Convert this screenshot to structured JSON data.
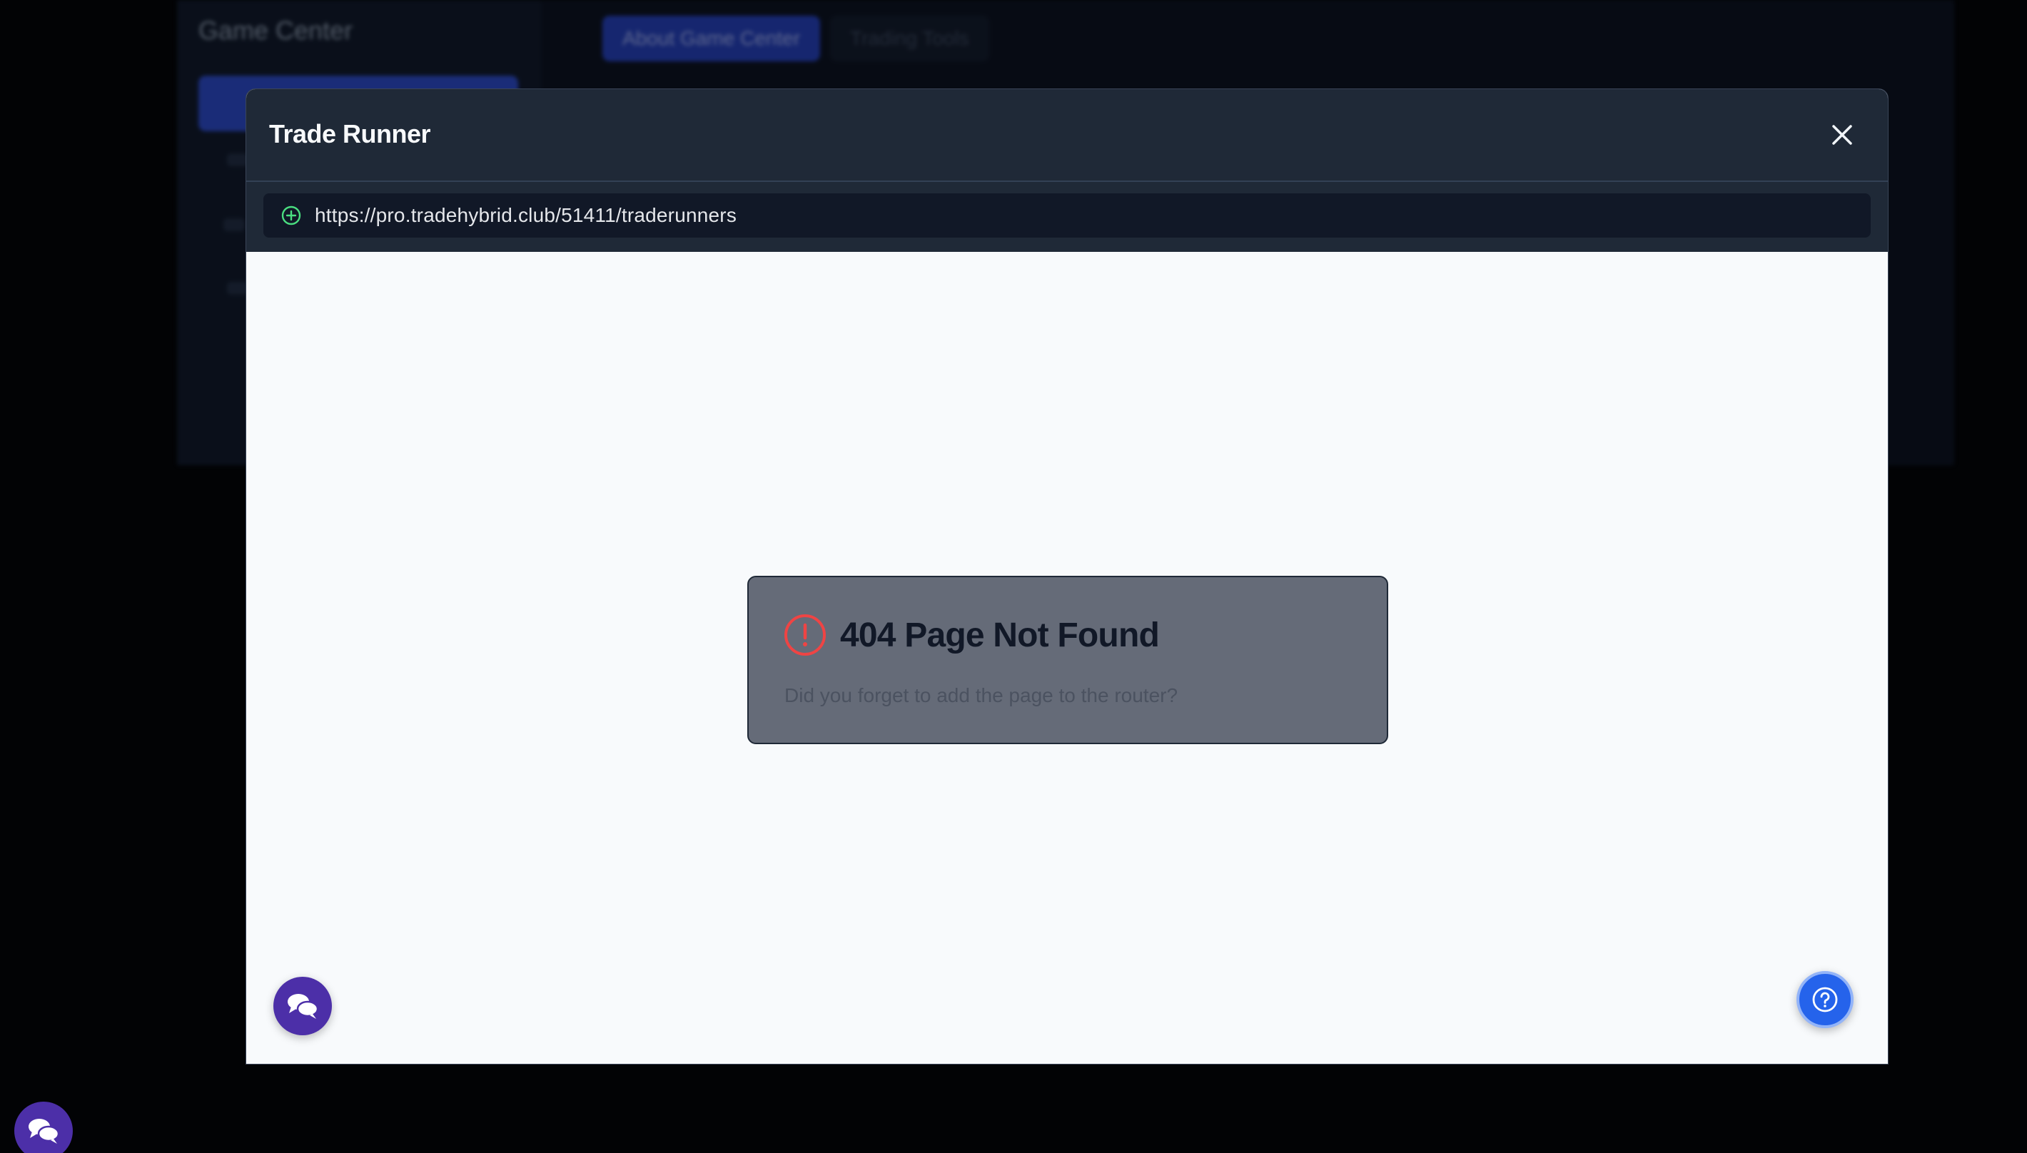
{
  "background": {
    "sidebar": {
      "title": "Game Center"
    },
    "tabs": [
      {
        "label": "About Game Center"
      },
      {
        "label": "Trading Tools"
      }
    ]
  },
  "modal": {
    "title": "Trade Runner",
    "close_icon": "close-icon",
    "url_bar": {
      "icon": "plus-circle-icon",
      "url": "https://pro.tradehybrid.club/51411/traderunners"
    },
    "error": {
      "icon": "alert-circle-icon",
      "title": "404 Page Not Found",
      "description": "Did you forget to add the page to the router?"
    }
  },
  "floating_buttons": {
    "chat_icon": "chat-bubbles-icon",
    "help_icon": "help-circle-icon"
  },
  "colors": {
    "modal_header": "#1f2937",
    "url_bar": "#111827",
    "url_icon": "#4ade80",
    "error_icon": "#ef4444",
    "error_card": "#656b78",
    "chat_button": "#4c2fa8",
    "help_button": "#2563eb"
  }
}
